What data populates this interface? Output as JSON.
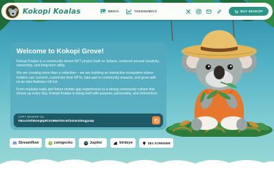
{
  "header": {
    "brand": "Kokopi Koalas",
    "nav": [
      {
        "label": "MEDIA",
        "icon": "image-icon"
      },
      {
        "label": "TOKENOMICS",
        "icon": "chart-icon"
      }
    ],
    "socials": [
      "x-icon",
      "instagram-icon",
      "email-icon",
      "link-icon"
    ],
    "buy_label": "BUY $KOKOP"
  },
  "main": {
    "title": "Welcome to Kokopi Grove!",
    "paragraphs": [
      "Kokopi Koalas is a community-driven NFT project built on Solana, centered around creativity, ownership, and long-term utility.",
      "We are creating more than a collection – we are building an interactive ecosystem where holders can connect, customize their NFTs, take part in community rewards, and grow with us as new features roll out.",
      "From modular traits and future mobile app experiences to a strong community culture that shows up every day, Kokopi Koalas is being built with purpose, personality, and momentum."
    ],
    "ca": {
      "label": "COPY $KOKOP CA",
      "value": "ENcwYGVhRsEqKpHt6zRHmVSGc9Cb6sWJG9ngpump"
    }
  },
  "partners": [
    {
      "label": "Streamflow",
      "icon": "streamflow-icon"
    },
    {
      "label": "coingecko",
      "icon": "coingecko-icon"
    },
    {
      "label": "Jupiter",
      "icon": "jupiter-icon"
    },
    {
      "label": "birdeye",
      "icon": "birdeye-icon"
    },
    {
      "label": "DEX SCREENER",
      "icon": "dexscreener-icon"
    }
  ],
  "colors": {
    "accent": "#2a9688",
    "brand_text": "#2c8b79",
    "copy_button": "#f08a3c",
    "card": "#54aabe"
  }
}
